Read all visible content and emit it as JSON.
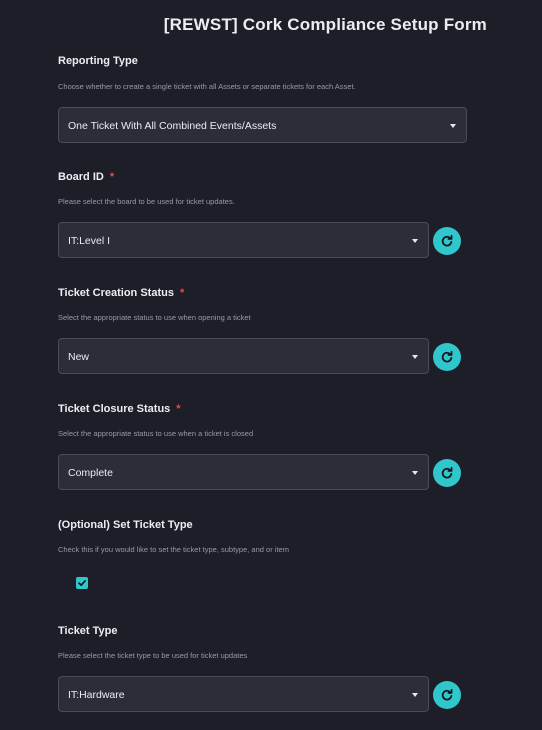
{
  "form": {
    "title": "[REWST] Cork Compliance Setup Form"
  },
  "fields": [
    {
      "label": "Reporting Type",
      "required": false,
      "help": "Choose whether to create a single ticket with all Assets or separate tickets for each Asset.",
      "value": "One Ticket With All Combined Events/Assets",
      "has_refresh": false
    },
    {
      "label": "Board ID",
      "required": true,
      "help": "Please select the board to be used for ticket updates.",
      "value": "IT:Level I",
      "has_refresh": true
    },
    {
      "label": "Ticket Creation Status",
      "required": true,
      "help": "Select the appropriate status to use when opening a ticket",
      "value": "New",
      "has_refresh": true
    },
    {
      "label": "Ticket Closure Status",
      "required": true,
      "help": "Select the appropriate status to use when a ticket is closed",
      "value": "Complete",
      "has_refresh": true
    },
    {
      "label": "(Optional) Set Ticket Type",
      "required": false,
      "help": "Check this if you would like to set the ticket type, subtype, and or item",
      "checked": true
    },
    {
      "label": "Ticket Type",
      "required": false,
      "help": "Please select the ticket type to be used for ticket updates",
      "value": "IT:Hardware",
      "has_refresh": true
    }
  ],
  "required_marker": "*",
  "icons": {
    "dropdown": "chevron-down-icon",
    "refresh": "refresh-icon",
    "check": "checkmark-icon"
  },
  "colors": {
    "background": "#1d1e27",
    "input_bg": "#2d2d3a",
    "accent": "#2fc6cc",
    "required": "#e05252"
  }
}
